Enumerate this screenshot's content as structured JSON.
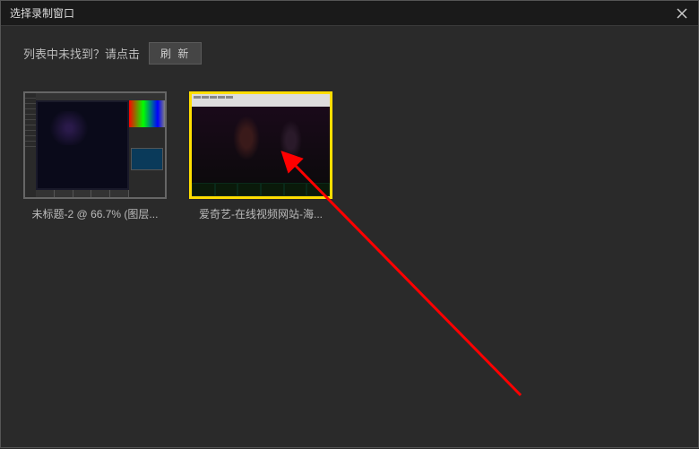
{
  "titlebar": {
    "title": "选择录制窗口"
  },
  "toolbar": {
    "prompt_text": "列表中未找到？请点击",
    "refresh_label": "刷 新"
  },
  "windows": [
    {
      "label": "未标题-2 @ 66.7% (图层...",
      "selected": false
    },
    {
      "label": "爱奇艺-在线视频网站-海...",
      "selected": true
    }
  ],
  "annotation": {
    "arrow_color": "#ff0000"
  }
}
